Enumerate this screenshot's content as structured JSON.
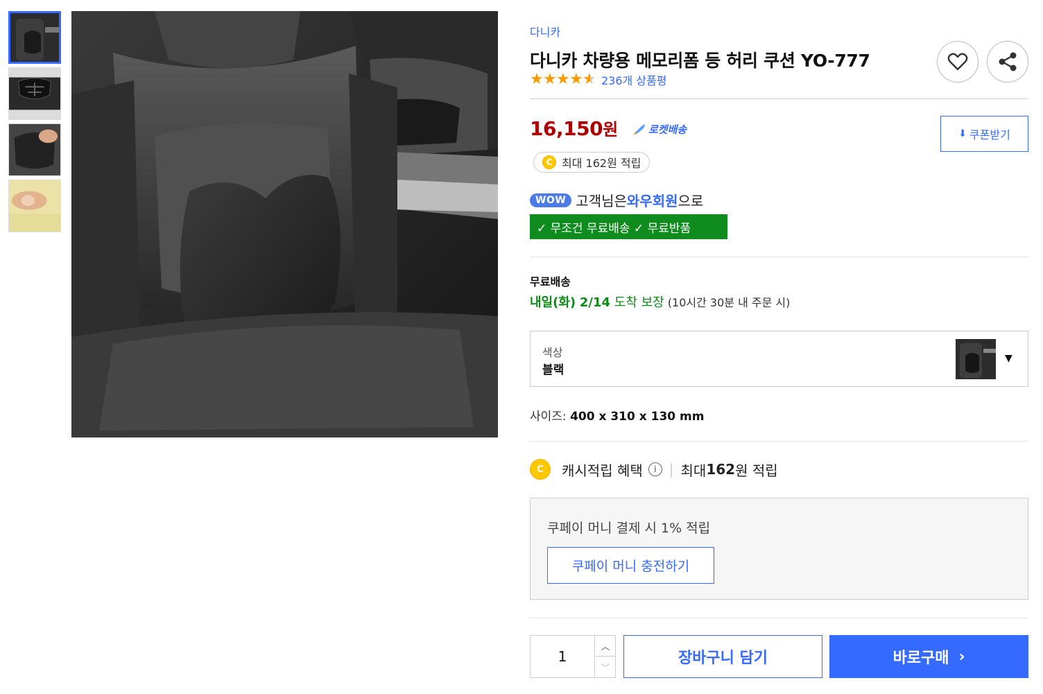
{
  "brand": "다니카",
  "title": "다니카 차량용 메모리폼 등 허리 쿠션 YO-777",
  "rating": {
    "stars": 4.5,
    "review_count": "236개 상품평"
  },
  "icons": {
    "heart": "heart-icon",
    "share": "share-icon"
  },
  "price": {
    "amount": "16,150",
    "unit": "원"
  },
  "rocket": {
    "label": "로켓배송"
  },
  "coupon": {
    "label": "쿠폰받기"
  },
  "cash_pill": {
    "coin": "C",
    "text": "최대 162원 적립"
  },
  "wow": {
    "badge": "WOW",
    "prefix": "고객님은 ",
    "strong": "와우회원",
    "suffix": "으로",
    "free_text": "✓ 무조건 무료배송 ✓ 무료반품"
  },
  "shipping": {
    "title": "무료배송",
    "day": "내일(화)",
    "date": "2/14",
    "arrive": " 도착 보장",
    "note": " (10시간 30분 내 주문 시)"
  },
  "option": {
    "label": "색상",
    "value": "블랙"
  },
  "size": {
    "label": "사이즈: ",
    "value": "400 x 310 x 130 mm"
  },
  "cash_benefit": {
    "coin": "C",
    "label": "캐시적립 혜택",
    "info": "i",
    "prefix": "최대 ",
    "amount": "162",
    "suffix": "원 적립"
  },
  "coupay": {
    "text": "쿠페이 머니 결제 시 1% 적립",
    "button": "쿠페이 머니 충전하기"
  },
  "quantity": {
    "value": "1"
  },
  "cart_button": "장바구니 담기",
  "buy_button": "바로구매",
  "colors": {
    "accent": "#346aff",
    "price": "#ae0000",
    "green": "#0c8a16",
    "free_bar": "#0e8d1e"
  }
}
